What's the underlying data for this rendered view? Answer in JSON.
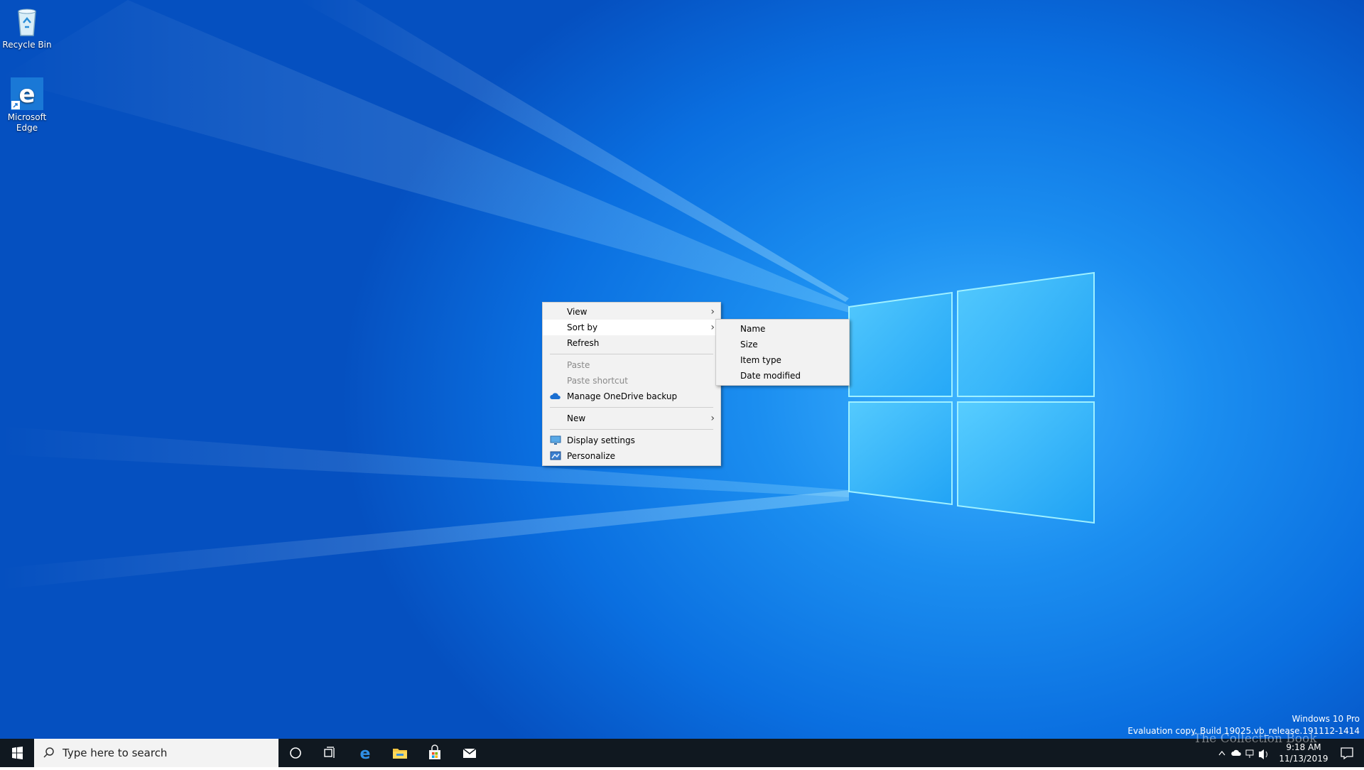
{
  "desktop": {
    "icons": [
      {
        "label": "Recycle Bin",
        "icon": "recycle-bin-icon"
      },
      {
        "label": "Microsoft Edge",
        "icon": "edge-icon"
      }
    ]
  },
  "context_menu": {
    "items": {
      "view": "View",
      "sort_by": "Sort by",
      "refresh": "Refresh",
      "paste": "Paste",
      "paste_shortcut": "Paste shortcut",
      "onedrive": "Manage OneDrive backup",
      "new": "New",
      "display_settings": "Display settings",
      "personalize": "Personalize"
    }
  },
  "sort_submenu": {
    "items": [
      "Name",
      "Size",
      "Item type",
      "Date modified"
    ]
  },
  "watermark": {
    "line1": "Windows 10 Pro",
    "line2": "Evaluation copy. Build 19025.vb_release.191112-1414"
  },
  "taskbar": {
    "search_placeholder": "Type here to search",
    "time": "9:18 AM",
    "date": "11/13/2019",
    "brand_overlay": "The Collection Book",
    "colors": {
      "bar": "#101820",
      "accent": "#0078d7"
    }
  }
}
